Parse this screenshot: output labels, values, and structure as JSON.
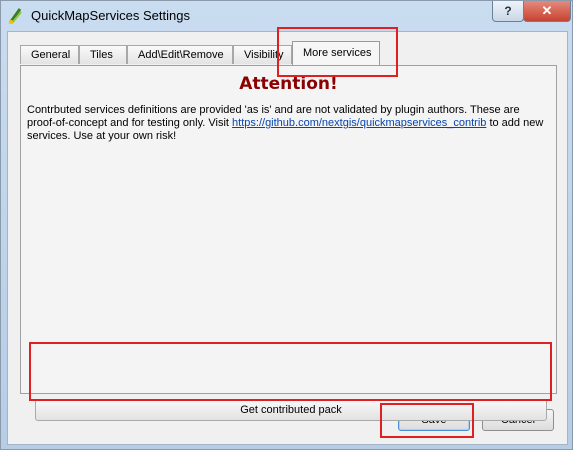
{
  "window": {
    "title": "QuickMapServices Settings",
    "help_label": "?",
    "close_label": "✕"
  },
  "tabs": [
    {
      "label": "General"
    },
    {
      "label": "Tiles"
    },
    {
      "label": "Add\\Edit\\Remove"
    },
    {
      "label": "Visibility"
    },
    {
      "label": "More services",
      "active": true
    }
  ],
  "more_services": {
    "heading": "Attention!",
    "text_before_link": "Contrbuted services definitions are provided 'as is' and are not validated by plugin authors. These are proof-of-concept and for testing only. Visit ",
    "link": "https://github.com/nextgis/quickmapservices_contrib",
    "text_after_link": " to add new services. Use at your own risk!",
    "get_pack_label": "Get contributed pack"
  },
  "buttons": {
    "save": "Save",
    "cancel": "Cancel"
  },
  "colors": {
    "heading": "#8b0000",
    "highlight": "#e02020",
    "link": "#0645ad"
  }
}
